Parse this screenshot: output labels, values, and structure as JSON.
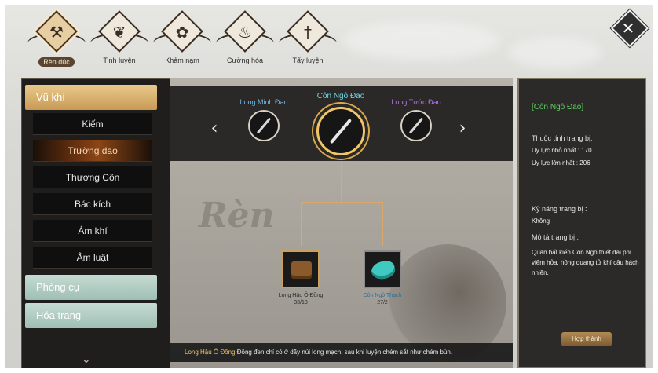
{
  "nav": {
    "items": [
      {
        "label": "Rèn đúc",
        "icon": "anvil-icon",
        "glyph": "⚒",
        "active": true
      },
      {
        "label": "Tinh luyện",
        "icon": "lotus-icon",
        "glyph": "❦",
        "active": false
      },
      {
        "label": "Khảm nạm",
        "icon": "gem-cluster-icon",
        "glyph": "✿",
        "active": false
      },
      {
        "label": "Cường hóa",
        "icon": "cauldron-icon",
        "glyph": "♨",
        "active": false
      },
      {
        "label": "Tẩy luyện",
        "icon": "sword-icon",
        "glyph": "†",
        "active": false
      }
    ],
    "close_glyph": "✕"
  },
  "sidebar": {
    "categories": [
      {
        "label": "Vũ khí",
        "style": "gold"
      },
      {
        "label": "Phòng cụ",
        "style": "mint"
      },
      {
        "label": "Hóa trang",
        "style": "mint"
      }
    ],
    "weapon_types": [
      {
        "label": "Kiếm",
        "active": false
      },
      {
        "label": "Trường đao",
        "active": true
      },
      {
        "label": "Thương Côn",
        "active": false
      },
      {
        "label": "Bác kích",
        "active": false
      },
      {
        "label": "Ám khí",
        "active": false
      },
      {
        "label": "Âm luật",
        "active": false
      }
    ],
    "scroll_glyph": "⌄"
  },
  "selector": {
    "prev_glyph": "‹",
    "next_glyph": "›",
    "weapons": [
      {
        "name": "Long Minh Đao",
        "color": "#6fb9e8",
        "selected": false
      },
      {
        "name": "Côn Ngô Đao",
        "color": "#6fd8e8",
        "selected": true
      },
      {
        "name": "Long Tước Đao",
        "color": "#b46fe8",
        "selected": false
      }
    ]
  },
  "watermark": "Rèn",
  "materials": [
    {
      "name": "Long Hậu Ô Đồng",
      "count": "33/18",
      "color": "#2a2a2a"
    },
    {
      "name": "Côn Ngô Thạch",
      "count": "27/2",
      "color": "#2a6f9b"
    }
  ],
  "infobar": {
    "highlight": "Long Hậu Ô Đồng",
    "text": " Đồng đen chỉ có ở dãy núi long mạch, sau khi luyện chém sắt như chém bùn."
  },
  "detail": {
    "title": "[Côn Ngô Đao]",
    "attr_heading": "Thuộc tính trang bị:",
    "min_power": "Uy lực nhỏ nhất : 170",
    "max_power": "Uy lực lớn nhất : 206",
    "skill_heading": "Kỹ năng trang bị :",
    "skill_value": "Không",
    "desc_heading": "Mô tả trang bị :",
    "desc": "Quân bất kiến Côn Ngô thiết dài phi viêm hỏa, hồng quang tử khí câu hách nhiên.",
    "craft_button": "Hợp thành"
  }
}
